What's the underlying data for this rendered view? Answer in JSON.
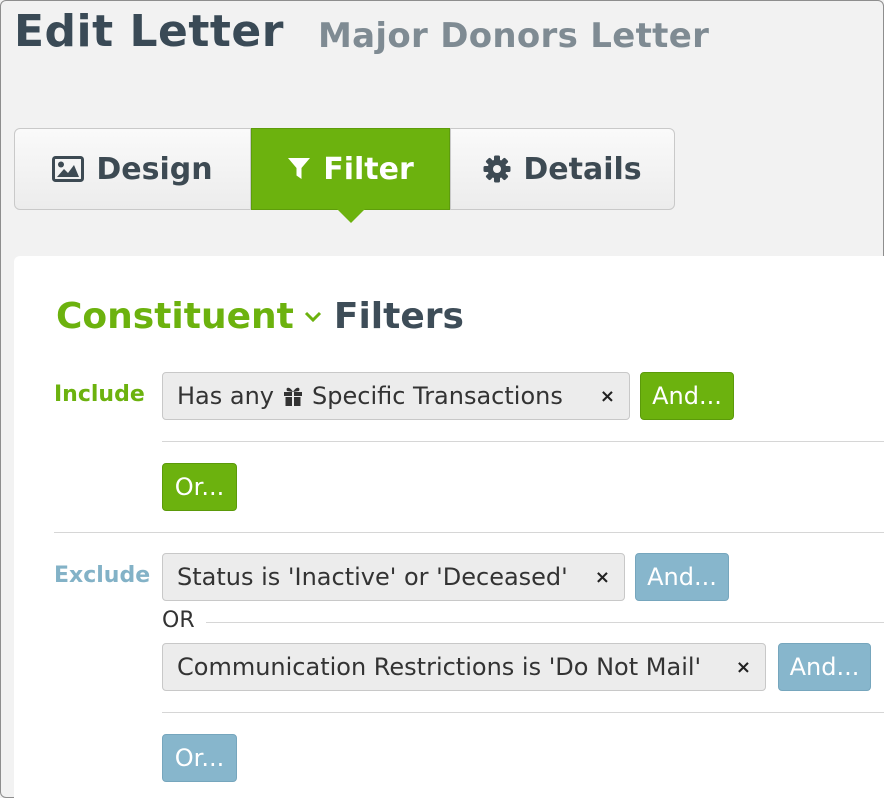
{
  "header": {
    "title": "Edit Letter",
    "subtitle": "Major Donors Letter"
  },
  "tabs": [
    {
      "label": "Design",
      "icon": "image-icon"
    },
    {
      "label": "Filter",
      "icon": "funnel-icon",
      "active": true
    },
    {
      "label": "Details",
      "icon": "gear-icon"
    }
  ],
  "filters": {
    "entity": "Constituent",
    "label": "Filters",
    "include": {
      "label": "Include",
      "conditions": [
        {
          "prefix": "Has any",
          "icon": "gift-icon",
          "suffix": "Specific Transactions",
          "remove": "×"
        }
      ],
      "and_label": "And...",
      "or_label": "Or..."
    },
    "exclude": {
      "label": "Exclude",
      "conditions": [
        {
          "text": "Status is 'Inactive' or 'Deceased'",
          "remove": "×"
        },
        {
          "text": "Communication Restrictions is 'Do Not Mail'",
          "remove": "×"
        }
      ],
      "separator": "OR",
      "and_label": "And...",
      "or_label": "Or..."
    }
  },
  "colors": {
    "accent_green": "#6cb20e",
    "accent_blue": "#87b6cc",
    "title_text": "#3a4a56",
    "subtitle_text": "#7f8b93"
  }
}
